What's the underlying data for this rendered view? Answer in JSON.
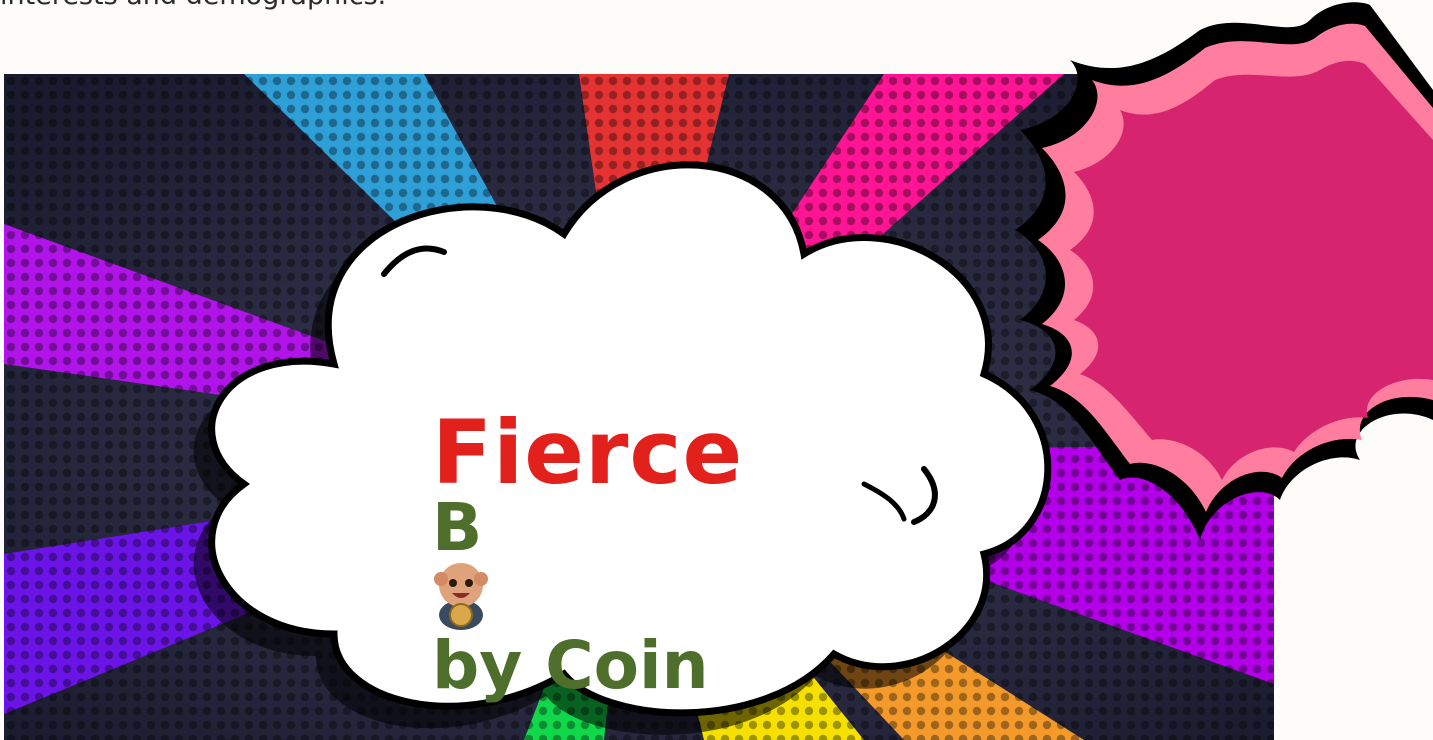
{
  "page": {
    "intro_text": "interests and demographics."
  },
  "banner": {
    "logo_line1": "Fierce",
    "logo_b": "B",
    "logo_rest": "by Coin",
    "colors": {
      "logo_red": "#e3211c",
      "logo_green": "#4e6e2b",
      "burst_pink": "#d6246e",
      "background_dark": "#1a1a2e"
    },
    "icons": {
      "mascot": "baby-mascot-icon"
    }
  }
}
